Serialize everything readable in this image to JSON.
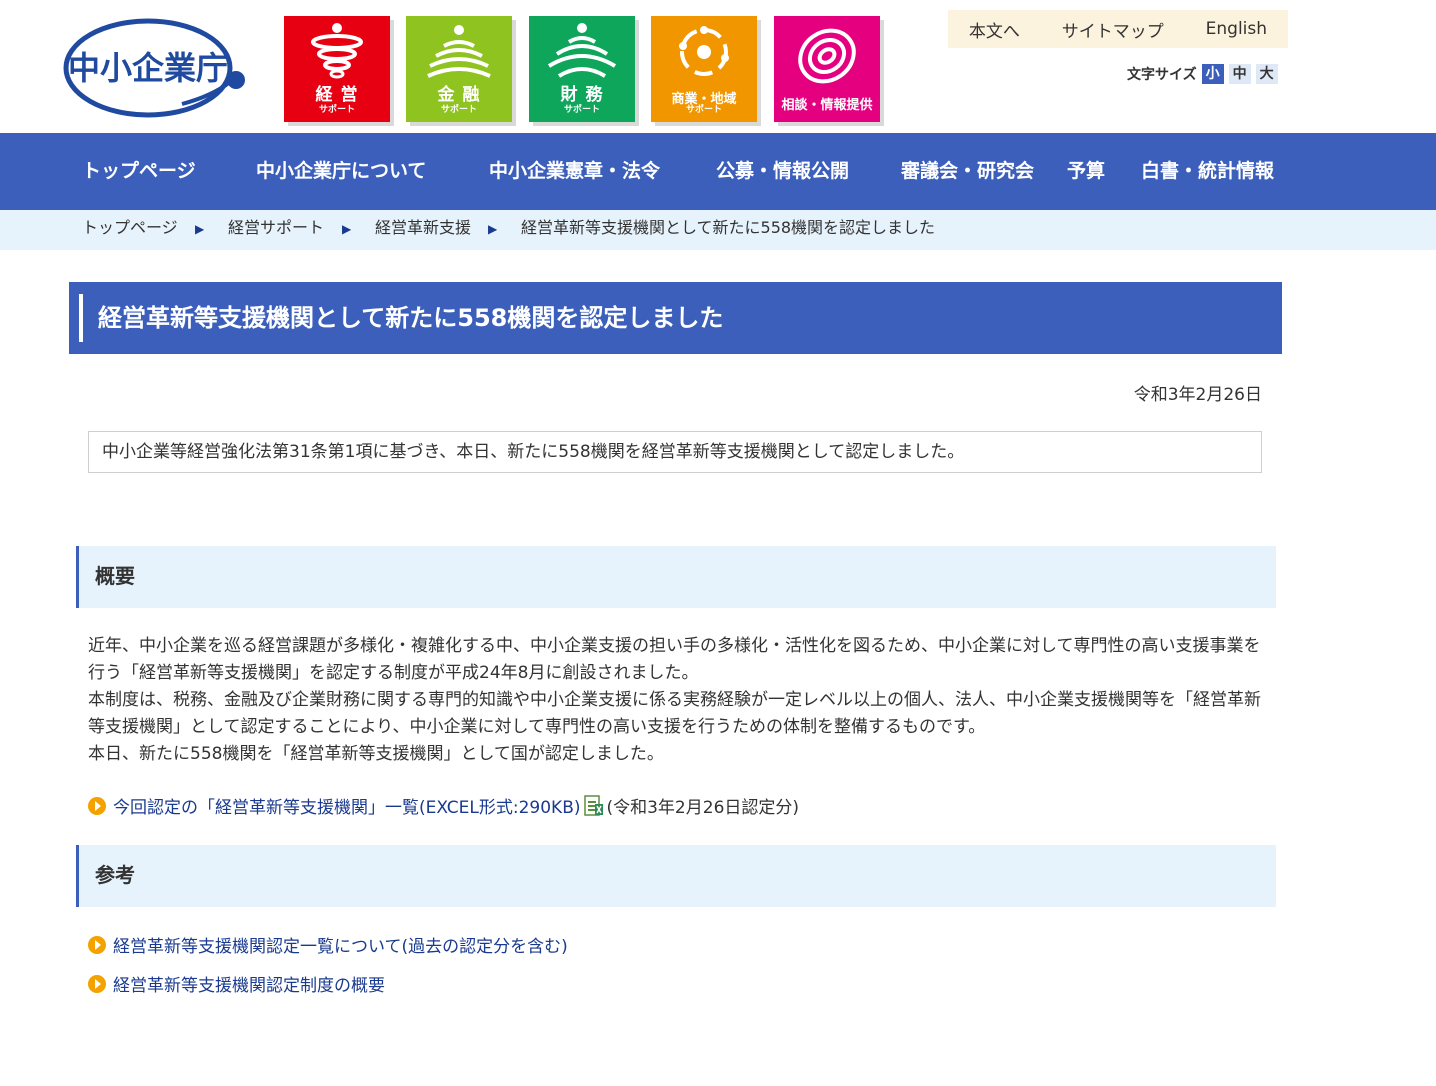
{
  "header": {
    "logo_text": "中小企業庁",
    "categories": [
      {
        "label": "経 営",
        "sub": "サポート",
        "color": "#e60012"
      },
      {
        "label": "金 融",
        "sub": "サポート",
        "color": "#8fc31f"
      },
      {
        "label": "財 務",
        "sub": "サポート",
        "color": "#0ea65a"
      },
      {
        "label": "商業・地域",
        "sub": "サポート",
        "color": "#f29600"
      },
      {
        "label": "相談・情報提供",
        "sub": "",
        "color": "#e4007f"
      }
    ],
    "util_links": [
      "本文へ",
      "サイトマップ",
      "English"
    ],
    "font_size_label": "文字サイズ",
    "font_sizes": [
      "小",
      "中",
      "大"
    ]
  },
  "gnav": [
    "トップページ",
    "中小企業庁について",
    "中小企業憲章・法令",
    "公募・情報公開",
    "審議会・研究会",
    "予算",
    "白書・統計情報"
  ],
  "breadcrumb": [
    "トップページ",
    "経営サポート",
    "経営革新支援",
    "経営革新等支援機関として新たに558機関を認定しました"
  ],
  "breadcrumb_sep": "▶",
  "page": {
    "title": "経営革新等支援機関として新たに558機関を認定しました",
    "date": "令和3年2月26日",
    "lead": "中小企業等経営強化法第31条第1項に基づき、本日、新たに558機関を経営革新等支援機関として認定しました。"
  },
  "overview": {
    "heading": "概要",
    "paragraphs": [
      "近年、中小企業を巡る経営課題が多様化・複雑化する中、中小企業支援の担い手の多様化・活性化を図るため、中小企業に対して専門性の高い支援事業を行う「経営革新等支援機関」を認定する制度が平成24年8月に創設されました。",
      "本制度は、税務、金融及び企業財務に関する専門的知識や中小企業支援に係る実務経験が一定レベル以上の個人、法人、中小企業支援機関等を「経営革新等支援機関」として認定することにより、中小企業に対して専門性の高い支援を行うための体制を整備するものです。",
      "本日、新たに558機関を「経営革新等支援機関」として国が認定しました。"
    ],
    "link_text": "今回認定の「経営革新等支援機関」一覧(EXCEL形式:290KB)",
    "link_note": "(令和3年2月26日認定分)"
  },
  "reference": {
    "heading": "参考",
    "links": [
      "経営革新等支援機関認定一覧について(過去の認定分を含む)",
      "経営革新等支援機関認定制度の概要"
    ]
  },
  "colors": {
    "brand_blue": "#3c5fbb",
    "light_blue": "#e7f3fc",
    "link": "#1a3a8f",
    "bullet": "#f3a200"
  }
}
